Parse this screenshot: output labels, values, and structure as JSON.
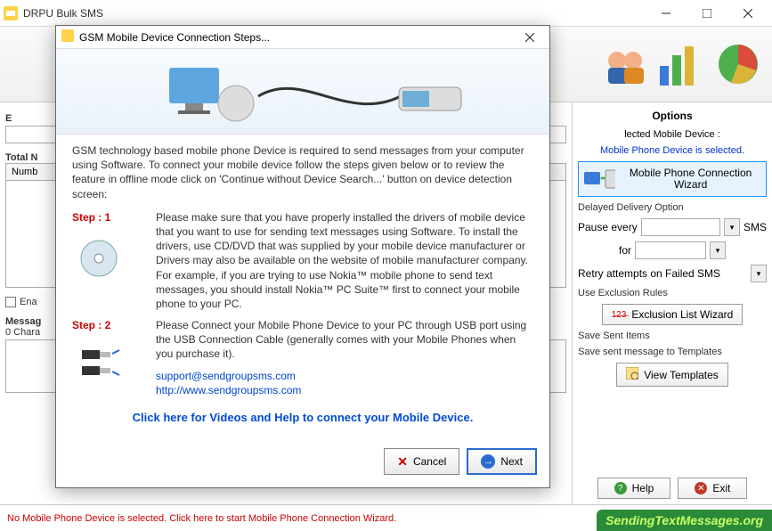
{
  "main_window": {
    "title": "DRPU Bulk SMS",
    "status_text": "No Mobile Phone Device is selected. Click here to start Mobile Phone Connection Wizard.",
    "left": {
      "total_label_prefix": "Total N",
      "list_header": "Numb",
      "enable_checkbox": "Ena",
      "message_row_label": "Messag",
      "characters_label": "0 Chara",
      "e_label": "E"
    },
    "buttons": {
      "help": "Help",
      "exit": "Exit"
    }
  },
  "options": {
    "title": "Options",
    "selected_label": "lected Mobile Device :",
    "selected_value": "Mobile Phone Device is selected.",
    "wizard_button": "Mobile Phone Connection  Wizard",
    "delayed_label": "Delayed Delivery Option",
    "pause_every": "Pause every",
    "sms_suffix": "SMS",
    "for_label": "for",
    "retry_label": "Retry attempts on Failed SMS",
    "exclusion_label": "Use Exclusion Rules",
    "exclusion_button": "Exclusion List Wizard",
    "save_sent_label": "Save Sent Items",
    "save_template_label": "Save sent message to Templates",
    "view_templates": "View Templates"
  },
  "dialog": {
    "title": "GSM Mobile Device Connection Steps...",
    "intro": "GSM technology based mobile phone Device is required to send messages from your computer using Software.  To connect your mobile device follow the steps given below or to review the feature in offline mode click on 'Continue without Device Search...' button on device detection screen:",
    "step1_label": "Step : 1",
    "step1_text": "Please make sure that you have properly installed the drivers of mobile device that you want to use for sending text messages using Software. To install the drivers, use CD/DVD that was supplied by your mobile device manufacturer or Drivers may also be available on the website of mobile manufacturer company.\nFor example, if you are trying to use Nokia™ mobile phone to send text messages, you should install Nokia™ PC Suite™ first to connect your mobile phone to your PC.",
    "step2_label": "Step : 2",
    "step2_text": "Please Connect your Mobile Phone Device to your PC through USB port using the USB Connection Cable (generally comes with your Mobile Phones when you purchase it).",
    "support_link": "support@sendgroupsms.com",
    "site_link": "http://www.sendgroupsms.com",
    "video_link": "Click here for Videos and Help to connect your Mobile Device.",
    "cancel": "Cancel",
    "next": "Next"
  },
  "branding": "SendingTextMessages.org"
}
